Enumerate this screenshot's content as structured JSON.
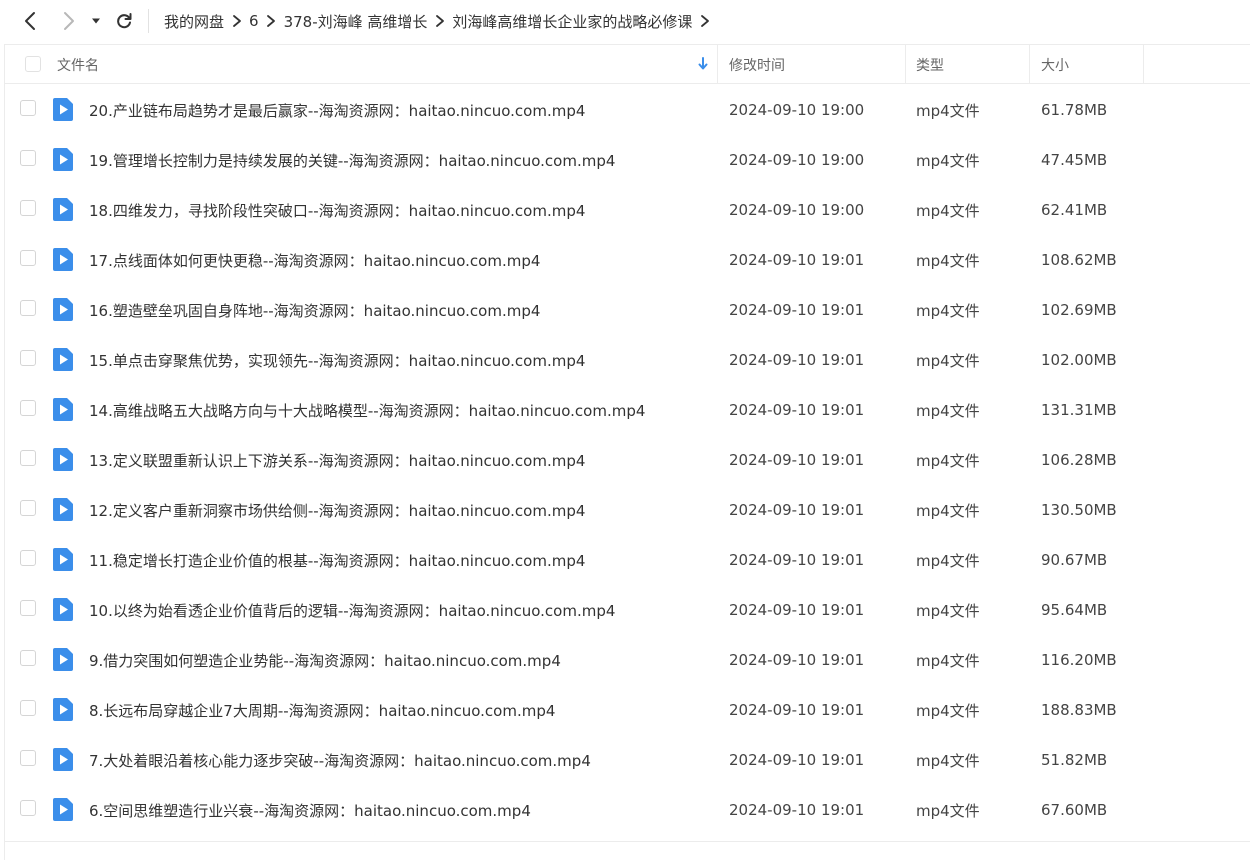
{
  "toolbar": {
    "back_icon": "chevron-left-icon",
    "forward_icon": "chevron-right-icon",
    "history_dropdown_icon": "caret-down-icon",
    "refresh_icon": "refresh-icon"
  },
  "breadcrumb": [
    "我的网盘",
    "6",
    "378-刘海峰 高维增长",
    "刘海峰高维增长企业家的战略必修课"
  ],
  "columns": {
    "name": "文件名",
    "modified": "修改时间",
    "type": "类型",
    "size": "大小"
  },
  "colors": {
    "accent": "#3b8eea",
    "file_icon": "#3b8eea",
    "text": "#333333",
    "muted": "#666666",
    "border": "#ececec"
  },
  "files": [
    {
      "name": "20.产业链布局趋势才是最后赢家--海淘资源网：haitao.nincuo.com.mp4",
      "modified": "2024-09-10 19:00",
      "type": "mp4文件",
      "size": "61.78MB"
    },
    {
      "name": "19.管理增长控制力是持续发展的关键--海淘资源网：haitao.nincuo.com.mp4",
      "modified": "2024-09-10 19:00",
      "type": "mp4文件",
      "size": "47.45MB"
    },
    {
      "name": "18.四维发力，寻找阶段性突破口--海淘资源网：haitao.nincuo.com.mp4",
      "modified": "2024-09-10 19:00",
      "type": "mp4文件",
      "size": "62.41MB"
    },
    {
      "name": "17.点线面体如何更快更稳--海淘资源网：haitao.nincuo.com.mp4",
      "modified": "2024-09-10 19:01",
      "type": "mp4文件",
      "size": "108.62MB"
    },
    {
      "name": "16.塑造壁垒巩固自身阵地--海淘资源网：haitao.nincuo.com.mp4",
      "modified": "2024-09-10 19:01",
      "type": "mp4文件",
      "size": "102.69MB"
    },
    {
      "name": "15.单点击穿聚焦优势，实现领先--海淘资源网：haitao.nincuo.com.mp4",
      "modified": "2024-09-10 19:01",
      "type": "mp4文件",
      "size": "102.00MB"
    },
    {
      "name": "14.高维战略五大战略方向与十大战略模型--海淘资源网：haitao.nincuo.com.mp4",
      "modified": "2024-09-10 19:01",
      "type": "mp4文件",
      "size": "131.31MB"
    },
    {
      "name": "13.定义联盟重新认识上下游关系--海淘资源网：haitao.nincuo.com.mp4",
      "modified": "2024-09-10 19:01",
      "type": "mp4文件",
      "size": "106.28MB"
    },
    {
      "name": "12.定义客户重新洞察市场供给侧--海淘资源网：haitao.nincuo.com.mp4",
      "modified": "2024-09-10 19:01",
      "type": "mp4文件",
      "size": "130.50MB"
    },
    {
      "name": "11.稳定增长打造企业价值的根基--海淘资源网：haitao.nincuo.com.mp4",
      "modified": "2024-09-10 19:01",
      "type": "mp4文件",
      "size": "90.67MB"
    },
    {
      "name": "10.以终为始看透企业价值背后的逻辑--海淘资源网：haitao.nincuo.com.mp4",
      "modified": "2024-09-10 19:01",
      "type": "mp4文件",
      "size": "95.64MB"
    },
    {
      "name": "9.借力突围如何塑造企业势能--海淘资源网：haitao.nincuo.com.mp4",
      "modified": "2024-09-10 19:01",
      "type": "mp4文件",
      "size": "116.20MB"
    },
    {
      "name": "8.长远布局穿越企业7大周期--海淘资源网：haitao.nincuo.com.mp4",
      "modified": "2024-09-10 19:01",
      "type": "mp4文件",
      "size": "188.83MB"
    },
    {
      "name": "7.大处着眼沿着核心能力逐步突破--海淘资源网：haitao.nincuo.com.mp4",
      "modified": "2024-09-10 19:01",
      "type": "mp4文件",
      "size": "51.82MB"
    },
    {
      "name": "6.空间思维塑造行业兴衰--海淘资源网：haitao.nincuo.com.mp4",
      "modified": "2024-09-10 19:01",
      "type": "mp4文件",
      "size": "67.60MB"
    }
  ]
}
